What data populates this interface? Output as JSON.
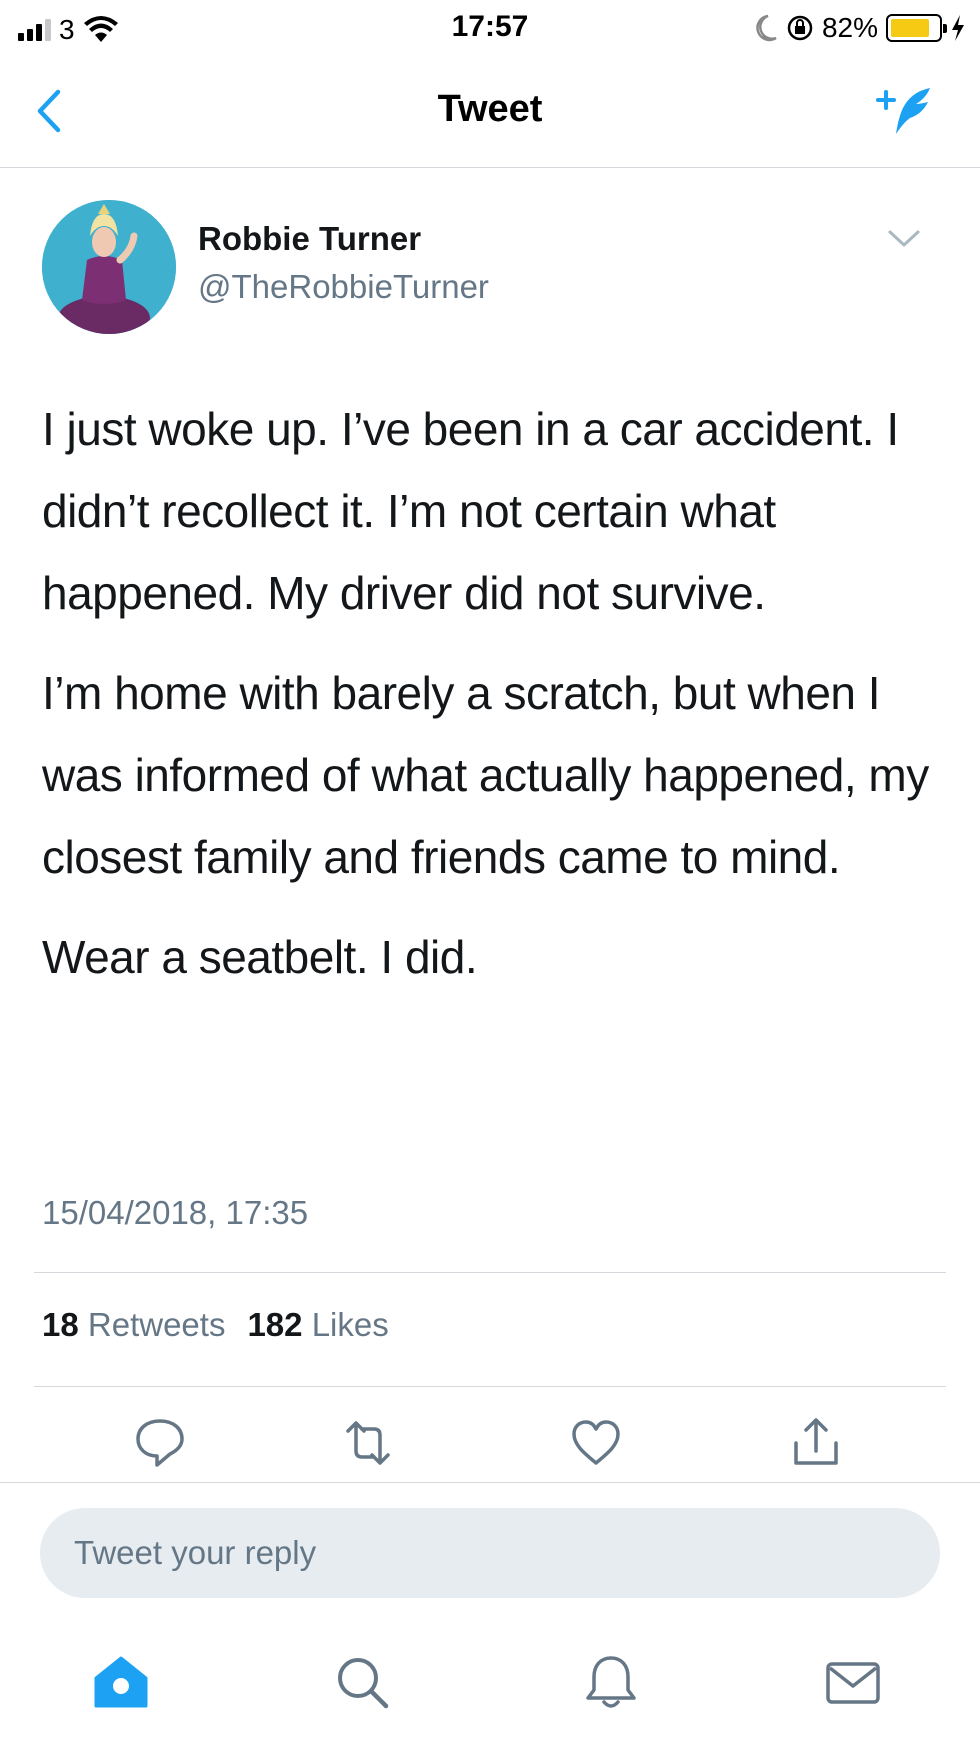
{
  "status_bar": {
    "carrier": "3",
    "time": "17:57",
    "battery_percent": "82%",
    "battery_level": 0.82,
    "battery_color": "#f6c913"
  },
  "nav": {
    "title": "Tweet",
    "back_icon": "chevron-left-icon",
    "compose_icon": "compose-tweet-icon",
    "accent": "#1da1f2"
  },
  "tweet": {
    "author_name": "Robbie Turner",
    "author_handle": "@TheRobbieTurner",
    "paragraphs": [
      "I just woke up. I’ve been in a car accident. I didn’t recollect it. I’m not certain what happened. My driver did not survive.",
      "I’m home with barely a scratch, but when I was informed of what actually happened, my closest family and friends came to mind.",
      "Wear a seatbelt. I did."
    ],
    "timestamp": "15/04/2018, 17:35",
    "retweets_count": "18",
    "retweets_label": "Retweets",
    "likes_count": "182",
    "likes_label": "Likes"
  },
  "actions": [
    "reply-icon",
    "retweet-icon",
    "like-icon",
    "share-icon"
  ],
  "reply": {
    "placeholder": "Tweet your reply"
  },
  "tabbar": [
    "home-icon",
    "search-icon",
    "notifications-icon",
    "messages-icon"
  ],
  "colors": {
    "text": "#14171a",
    "secondary": "#657786",
    "divider": "#d5d9dd",
    "reply_bg": "#e6ecf0",
    "icon": "#657786",
    "accent": "#1da1f2"
  }
}
